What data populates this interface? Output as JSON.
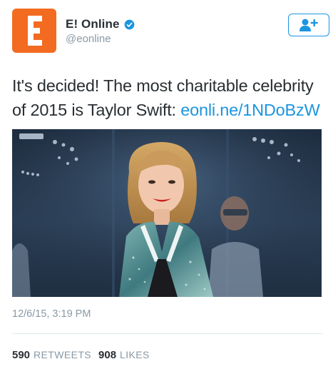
{
  "header": {
    "display_name": "E! Online",
    "handle": "@eonline",
    "avatar_icon": "e-online-logo",
    "verified_icon": "verified-badge-icon",
    "follow_icon": "follow-user-plus-icon",
    "brand_color": "#f26b21",
    "accent_color": "#1b95e0"
  },
  "tweet": {
    "text": "It's decided! The most charitable celebrity of 2015 is Taylor Swift: ",
    "link_text": "eonli.ne/1NDoBzW"
  },
  "media": {
    "type": "photo"
  },
  "meta": {
    "timestamp": "12/6/15, 3:19 PM"
  },
  "stats": {
    "retweets_count": "590",
    "retweets_label": "RETWEETS",
    "likes_count": "908",
    "likes_label": "LIKES"
  }
}
